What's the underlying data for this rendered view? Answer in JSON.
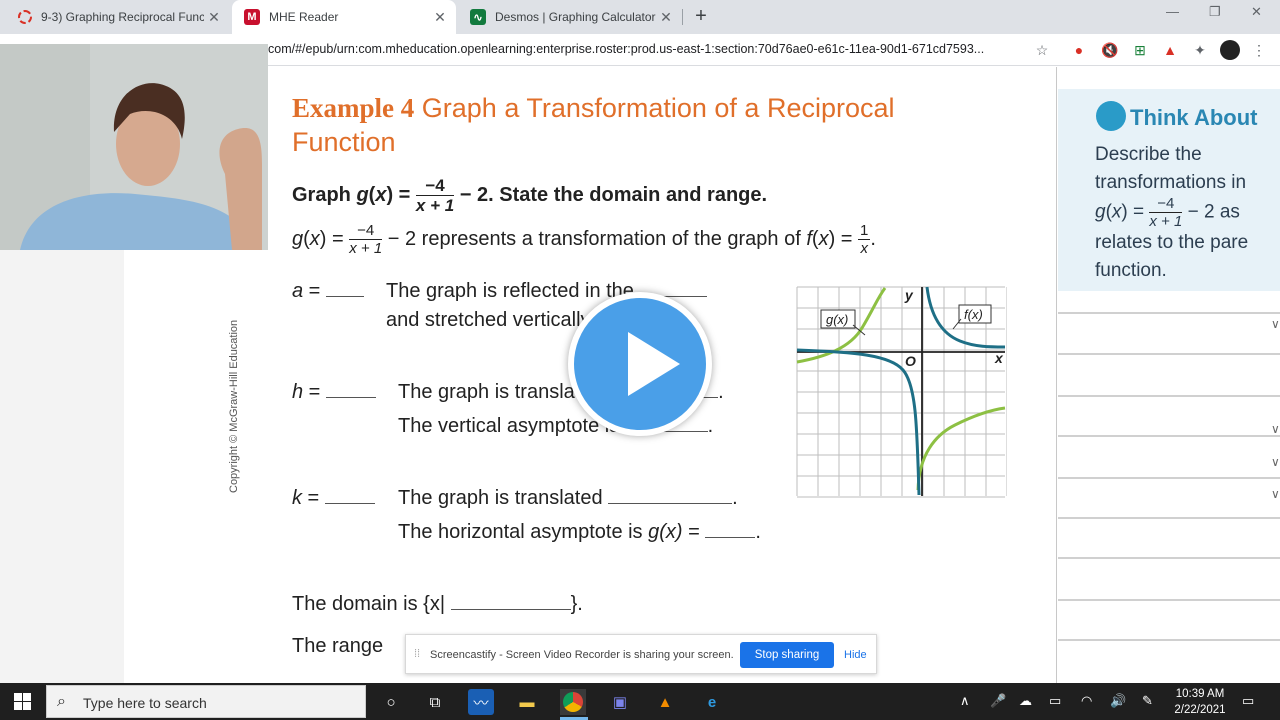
{
  "browser": {
    "tabs": [
      {
        "title": "9-3) Graphing Reciprocal Functio",
        "icon": "loader-icon",
        "active": false
      },
      {
        "title": "MHE Reader",
        "icon": "mhe-logo-icon",
        "active": true
      },
      {
        "title": "Desmos | Graphing Calculator",
        "icon": "desmos-logo-icon",
        "active": false
      }
    ],
    "new_tab": "+",
    "url_prefix": "com/#/epub/urn:com.mheducation.openlearning:enterprise.roster:prod.us-east-1:section:70d76ae0-e61c-11ea-90d1-671cd7593..."
  },
  "lesson": {
    "example_number": "Example 4",
    "example_title": "Graph a Transformation of a Reciprocal Function",
    "task_prefix": "Graph ",
    "task_fn": "g",
    "task_var": "x",
    "task_num": "−4",
    "task_den": "x + 1",
    "task_suffix": " − 2. State the domain and range.",
    "repr_num": "−4",
    "repr_den": "x + 1",
    "repr_mid": " − 2 represents a transformation of the graph of ",
    "repr_f_num": "1",
    "repr_f_den": "x",
    "a_label": "a",
    "a_line1": "The graph is reflected in the",
    "a_line2": "and stretched vertically",
    "h_label": "h",
    "h_line1": "The graph is translated",
    "h_line2": "The vertical asymptote is",
    "h_var": "x",
    "k_label": "k",
    "k_line1": "The graph is translated",
    "k_line2": "The horizontal asymptote is",
    "k_fn": "g(x)",
    "domain_text": "The domain is {x|",
    "domain_close": "}.",
    "range_text": "The range",
    "copyright": "Copyright © McGraw-Hill Education"
  },
  "graph": {
    "g_label": "g(x)",
    "f_label": "f(x)",
    "x_axis": "x",
    "y_axis": "y",
    "origin": "O",
    "colors": {
      "g": "#8dc043",
      "f": "#1e6f86",
      "axis": "#222222",
      "grid": "#bdbdbd"
    }
  },
  "sidebar": {
    "think_title": "Think About",
    "think_line1": "Describe the",
    "think_line2": "transformations in",
    "think_num": "−4",
    "think_den": "x + 1",
    "think_tail": " − 2 as",
    "think_line4": "relates to the pare",
    "think_line5": "function."
  },
  "screencastify": {
    "message": "Screencastify - Screen Video Recorder is sharing your screen.",
    "stop_label": "Stop sharing",
    "hide_label": "Hide"
  },
  "taskbar": {
    "search_placeholder": "Type here to search",
    "time": "10:39 AM",
    "date": "2/22/2021"
  }
}
